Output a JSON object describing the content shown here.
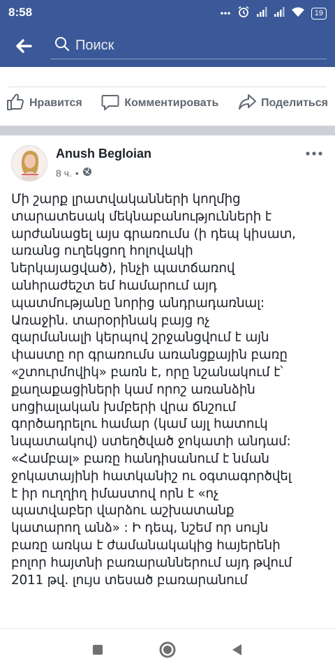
{
  "status_bar": {
    "time": "8:58",
    "battery": "19",
    "icons": [
      "dots-icon",
      "alarm-icon",
      "signal-icon",
      "signal-icon",
      "wifi-icon",
      "battery-icon"
    ]
  },
  "search": {
    "placeholder": "Поиск"
  },
  "previous_post_actions": {
    "like_label": "Нравится",
    "comment_label": "Комментировать",
    "share_label": "Поделиться"
  },
  "post": {
    "author": "Anush Begloian",
    "time": "8 ч.",
    "separator": "•",
    "audience_icon": "globe-icon",
    "text": "Մի շարք լրատվականների կողմից\nտարատեսակ մեկնաբանությունների է\nարժանացել այս գրառումս (ի դեպ կիսատ,\nառանց ուղեկցող հոլովակի\nներկայացված), ինչի պատճառով\nանհրաժեշտ եմ համարում այդ\nպատմությանը նորից անդրադառնալ:\nԱռաջին. տարօրինակ  բայց ոչ\nզարմանալի կերպով շրջանցվում է  այն\nփաստը որ  գրառումս առանցքային բառը\n«շտուրմովիկ»  բառն է, որը նշանակում է՝\nքաղաքացիների կամ որոշ առանձին\nսոցիալական  խմբերի վրա ճնշում\nգործադրելու համար (կամ այլ հատուկ\nնպատակով) ստեղծված ջոկատի անդամ:\n«Համբալ» բառը հանդիսանում է նման\nջոկատայինի հատկանիշ ու օգտագործվել\nէ իր ուղղիղ իմաստով որն է «ոչ\nպատվաբեր  վարձու  աշխատանք\nկատարող անձ» : Ի դեպ, նշեմ որ սույն\nբառը առկա է ժամանակակից հայերենի\nբոլոր հայտնի բառարաններում այդ թվում\n2011 թվ. լույս տեսած բառարանում"
  },
  "colors": {
    "brand": "#3b5998",
    "text": "#1d2129",
    "secondary_text": "#606770",
    "separator": "#cdd0d5"
  },
  "nav_bar": {
    "buttons": [
      "recents-square-icon",
      "home-circle-icon",
      "back-triangle-icon"
    ]
  }
}
